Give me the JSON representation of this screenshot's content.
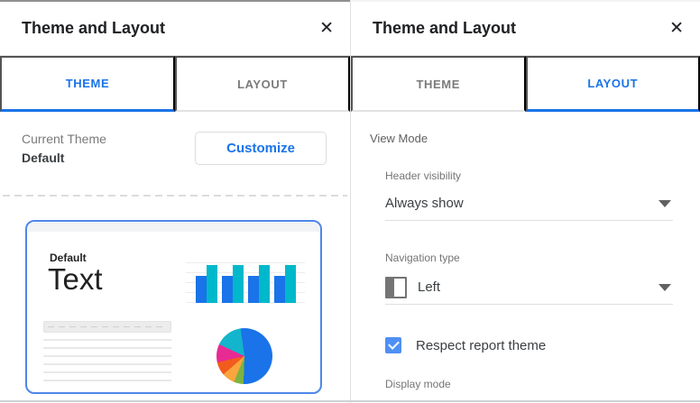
{
  "left_panel": {
    "title": "Theme and Layout",
    "close_icon": "✕",
    "tabs": [
      {
        "label": "THEME",
        "active": true
      },
      {
        "label": "LAYOUT",
        "active": false
      }
    ],
    "current_theme": {
      "label": "Current Theme",
      "value": "Default"
    },
    "customize_button_label": "Customize",
    "theme_preview": {
      "name": "Default",
      "sample_text": "Text"
    }
  },
  "right_panel": {
    "title": "Theme and Layout",
    "close_icon": "✕",
    "tabs": [
      {
        "label": "THEME",
        "active": false
      },
      {
        "label": "LAYOUT",
        "active": true
      }
    ],
    "view_mode_label": "View Mode",
    "header_visibility": {
      "label": "Header visibility",
      "value": "Always show"
    },
    "navigation_type": {
      "label": "Navigation type",
      "value": "Left"
    },
    "respect_report_theme": {
      "label": "Respect report theme",
      "checked": true
    },
    "display_mode_label": "Display mode"
  },
  "colors": {
    "accent_blue": "#1a73e8",
    "preview_border_blue": "#4e86e8",
    "checkbox_blue": "#4e90f5",
    "chart_blue": "#1a73e8",
    "chart_teal": "#00b8cb",
    "pie_blue": "#1a73e8",
    "pie_teal": "#12b5cb",
    "pie_pink": "#e82a93",
    "pie_orange": "#f25b1e",
    "pie_light_orange": "#faa53d",
    "pie_green": "#7cb342"
  }
}
